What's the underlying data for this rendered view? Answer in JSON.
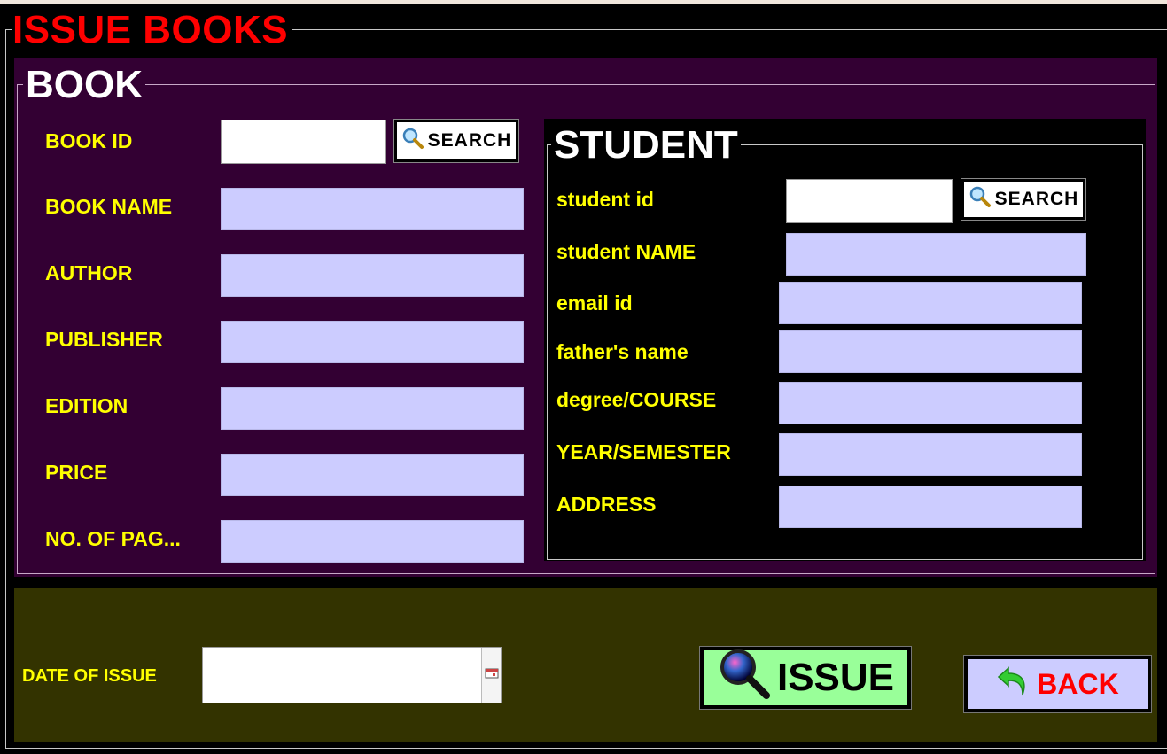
{
  "window": {
    "title": "ISSUE BOOKS"
  },
  "book": {
    "section_title": "BOOK",
    "labels": {
      "book_id": "BOOK ID",
      "book_name": "BOOK NAME",
      "author": "AUTHOR",
      "publisher": "PUBLISHER",
      "edition": "EDITION",
      "price": "PRICE",
      "pages": "NO. OF PAG..."
    },
    "values": {
      "book_id": "",
      "book_name": "",
      "author": "",
      "publisher": "",
      "edition": "",
      "price": "",
      "pages": ""
    },
    "search_label": "SEARCH",
    "search_icon": "magnifier-icon"
  },
  "student": {
    "section_title": "STUDENT",
    "labels": {
      "student_id": "student id",
      "student_name": "student  NAME",
      "email": "email  id",
      "father": "father's  name",
      "course": "degree/COURSE",
      "year": "YEAR/SEMESTER",
      "address": "ADDRESS"
    },
    "values": {
      "student_id": "",
      "student_name": "",
      "email": "",
      "father": "",
      "course": "",
      "year": "",
      "address": ""
    },
    "search_label": "SEARCH",
    "search_icon": "magnifier-icon"
  },
  "issue": {
    "date_label": "DATE OF ISSUE",
    "date_value": "",
    "issue_label": "ISSUE",
    "issue_icon": "magnifier-icon",
    "back_label": "BACK",
    "back_icon": "back-arrow-icon"
  },
  "colors": {
    "title_red": "#ff0000",
    "label_yellow": "#ffff00",
    "book_panel": "#330033",
    "bottom_panel": "#333300",
    "field_fill": "#ccccff",
    "issue_button": "#99ff99"
  }
}
